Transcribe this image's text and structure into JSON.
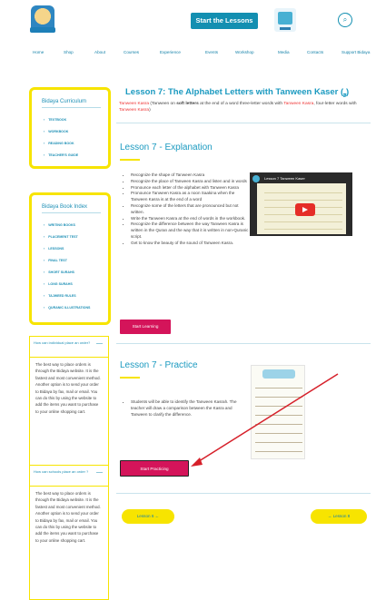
{
  "header": {
    "start_label": "Start the Lessons",
    "search_icon": "search-icon",
    "cart_icon": "cart-icon"
  },
  "nav": [
    "Home",
    "Shop",
    "About",
    "Courses",
    "Experience",
    "Events",
    "Workshop",
    "Media",
    "Contacts",
    "Support Bidaya"
  ],
  "sidebar": {
    "curriculum": {
      "title": "Bidaya Curriculum",
      "items": [
        "TEXTBOOK",
        "WORKBOOK",
        "READING BOOK",
        "TEACHER'S GUIDE"
      ]
    },
    "index": {
      "title": "Bidaya Book Index",
      "items": [
        "WRITING BOOKS",
        "PLACEMENT TEST",
        "LESSONS",
        "FINAL TEST",
        "SHORT SURAHS",
        "LONG SURAHS",
        "TAJWEED RULES",
        "QURANIC ILLUSTRATIONS"
      ]
    },
    "faq": [
      {
        "q": "How can individual place an order?",
        "a": "The best way to place orders is through the Bidaya website. It is the fastest and most convenient method. Another option is to send your order to Bidaya by fax, mail or email. You can do this by using the website to add the items you want to purchase to your online shopping cart."
      },
      {
        "q": "How can schools place an order ?",
        "a": "The best way to place orders is through the Bidaya website. It is the fastest and most convenient method. Another option is to send your order to Bidaya by fax, mail or email. You can do this by using the website to add the items you want to purchase to your online shopping cart."
      }
    ],
    "toggle": "—"
  },
  "main": {
    "title": "Lesson 7: The Alphabet Letters with Tanween Kaser (ـٍ)",
    "subtitle_red1": "Tanween Kasra",
    "subtitle_mid1": " (Tanween on ",
    "subtitle_bold": "soft letters",
    "subtitle_mid2": " at the end of a word three-letter words with ",
    "subtitle_red2": "Tanween Kasra",
    "subtitle_mid3": ", four-letter words with ",
    "subtitle_red3": "Tanween Kasra",
    "subtitle_end": ")",
    "explanation": {
      "heading": "Lesson 7 - Explanation",
      "bullets": [
        "Recognize the shape of Tanween Kasra",
        "Recognize the place of Tanween Kasra and listen and in words",
        "Pronounce each letter of the alphabet with Tanween Kasra",
        "Pronounce Tanween Kasra as a noon Saakina when the Tanween Kasra is at the end of a word",
        "Recognize some of the letters that are pronounced but not written.",
        "Write the Tanween Kasra at the end of words in the workbook.",
        "Recognize the difference between the way Tanween Kasra is written in the Quran and the way that it is written in non-Quranic script.",
        "Get to know the beauty of the sound of Tanween Kasra."
      ],
      "button": "Start Learning",
      "video_title": "Lesson 7 Tanween Kaser"
    },
    "practice": {
      "heading": "Lesson 7 - Practice",
      "bullet": "Students will be able to identify the Tanween Kasrah. The teacher will draw a comparison between the Kasra and Tanween to clarify the difference.",
      "button": "Start Practicing"
    },
    "prev_label": "Lesson 6",
    "next_label": "Lesson 8"
  },
  "colors": {
    "accent": "#1b9ac0",
    "yellow": "#f7e400",
    "pink": "#d4145a",
    "red": "#e33333"
  }
}
